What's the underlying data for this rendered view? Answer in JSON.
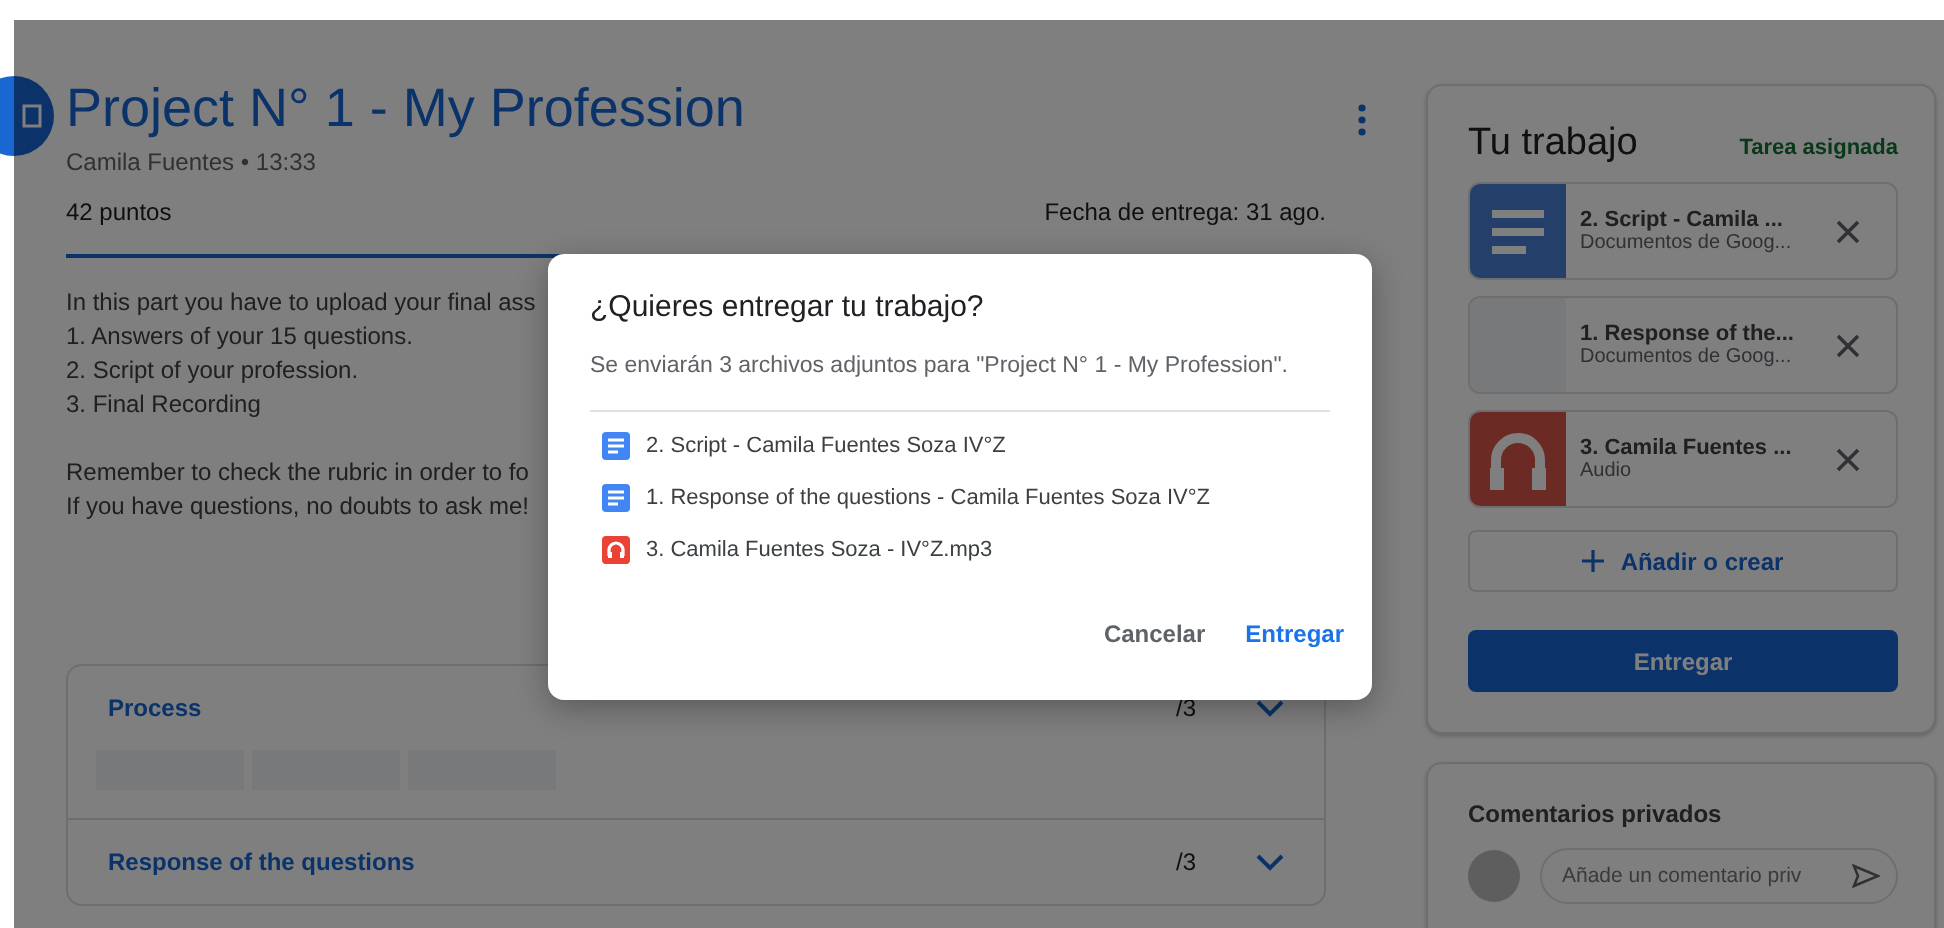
{
  "assignment": {
    "title": "Project N° 1 - My Profession",
    "byline": "Camila Fuentes • 13:33",
    "points": "42 puntos",
    "due": "Fecha de entrega: 31 ago.",
    "description": [
      {
        "lines": [
          "In this part you have to upload your final ass",
          "1. Answers of your 15 questions.",
          "2. Script of your profession.",
          "3. Final Recording"
        ]
      },
      {
        "lines": [
          "Remember to check the rubric in order to fo",
          "If you have questions, no doubts to ask me!"
        ]
      }
    ]
  },
  "rubric": [
    {
      "title": "Process",
      "score": "/3",
      "expanded": true
    },
    {
      "title": "Response of the questions",
      "score": "/3",
      "expanded": false
    }
  ],
  "your_work": {
    "title": "Tu trabajo",
    "status": "Tarea asignada",
    "attachments": [
      {
        "kind": "doc",
        "name": "2. Script - Camila ...",
        "type": "Documentos de Goog..."
      },
      {
        "kind": "blank",
        "name": "1. Response of the...",
        "type": "Documentos de Goog..."
      },
      {
        "kind": "audio",
        "name": "3. Camila Fuentes ...",
        "type": "Audio"
      }
    ],
    "add_label": "Añadir o crear",
    "submit_label": "Entregar"
  },
  "private_comments": {
    "title": "Comentarios privados",
    "placeholder": "Añade un comentario priv"
  },
  "dialog": {
    "title": "¿Quieres entregar tu trabajo?",
    "message": "Se enviarán 3 archivos adjuntos para \"Project N° 1 - My Profession\".",
    "files": [
      {
        "kind": "doc",
        "name": "2. Script - Camila Fuentes Soza IV°Z"
      },
      {
        "kind": "doc",
        "name": "1. Response of the questions - Camila Fuentes Soza IV°Z"
      },
      {
        "kind": "audio",
        "name": "3. Camila Fuentes Soza - IV°Z.mp3"
      }
    ],
    "cancel_label": "Cancelar",
    "submit_label": "Entregar"
  }
}
